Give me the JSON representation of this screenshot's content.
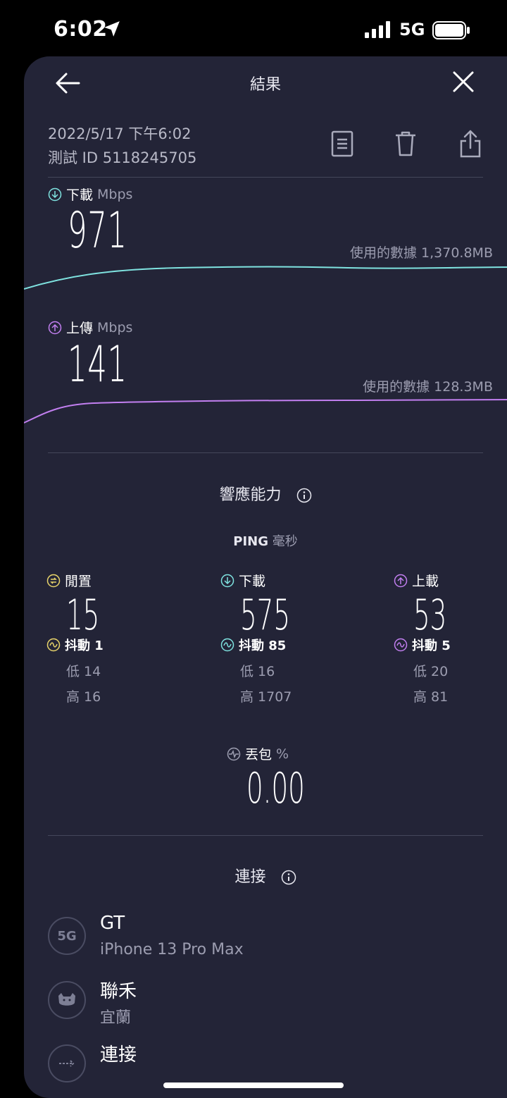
{
  "status_bar": {
    "time": "6:02",
    "network": "5G",
    "location_icon": "location-arrow-icon",
    "signal_icon": "cell-signal-icon",
    "battery_icon": "battery-icon"
  },
  "header": {
    "title": "結果",
    "back_icon": "back-arrow-icon",
    "close_icon": "close-icon"
  },
  "meta": {
    "date": "2022/5/17 下午6:02",
    "test_id": "測試 ID 5118245705"
  },
  "actions": {
    "list_icon": "document-list-icon",
    "trash_icon": "trash-icon",
    "share_icon": "share-icon"
  },
  "download": {
    "label": "下載",
    "unit": "Mbps",
    "value": "971",
    "data_used": "使用的數據 1,370.8MB",
    "color": "#7fe3e0"
  },
  "upload": {
    "label": "上傳",
    "unit": "Mbps",
    "value": "141",
    "data_used": "使用的數據 128.3MB",
    "color": "#c27ff0"
  },
  "responsiveness": {
    "title": "響應能力",
    "ping_title": "PING",
    "ping_unit": "毫秒",
    "idle": {
      "label": "閒置",
      "value": "15",
      "jitter": "抖動 1",
      "low": "低 14",
      "high": "高 16",
      "color": "#e8d46a"
    },
    "download": {
      "label": "下載",
      "value": "575",
      "jitter": "抖動 85",
      "low": "低 16",
      "high": "高 1707",
      "color": "#7fe3e0"
    },
    "upload": {
      "label": "上載",
      "value": "53",
      "jitter": "抖動 5",
      "low": "低 20",
      "high": "高 81",
      "color": "#c27ff0"
    }
  },
  "packet_loss": {
    "label": "丟包",
    "unit": "%",
    "value": "0.00"
  },
  "connection": {
    "title": "連接",
    "items": [
      {
        "icon_text": "5G",
        "name": "GT",
        "sub": "iPhone 13 Pro Max"
      },
      {
        "icon": "server-cat-icon",
        "name": "聯禾",
        "sub": "宜蘭"
      },
      {
        "icon": "connections-icon",
        "name": "連接",
        "sub": ""
      }
    ]
  }
}
